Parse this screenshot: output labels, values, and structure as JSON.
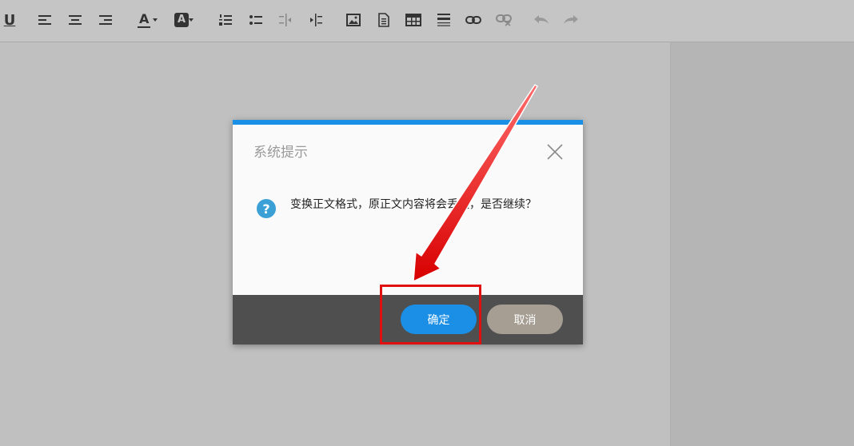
{
  "toolbar": {
    "icons": [
      "underline-icon",
      "align-left-icon",
      "align-center-icon",
      "align-right-icon",
      "font-color-icon",
      "highlight-color-icon",
      "ordered-list-icon",
      "unordered-list-icon",
      "outdent-icon",
      "indent-icon",
      "image-icon",
      "file-icon",
      "table-icon",
      "horizontal-rule-icon",
      "link-icon",
      "unlink-icon",
      "undo-icon",
      "redo-icon"
    ],
    "underline_glyph": "U",
    "font_color_glyph": "A",
    "highlight_glyph": "A"
  },
  "dialog": {
    "title": "系统提示",
    "message": "变换正文格式，原正文内容将会丢失，是否继续？",
    "ok_label": "确定",
    "cancel_label": "取消",
    "question_glyph": "?"
  },
  "colors": {
    "accent": "#1a8fe6",
    "cancel": "#a69e93",
    "footer": "#4f4f4f",
    "highlight_box": "#e01010"
  }
}
